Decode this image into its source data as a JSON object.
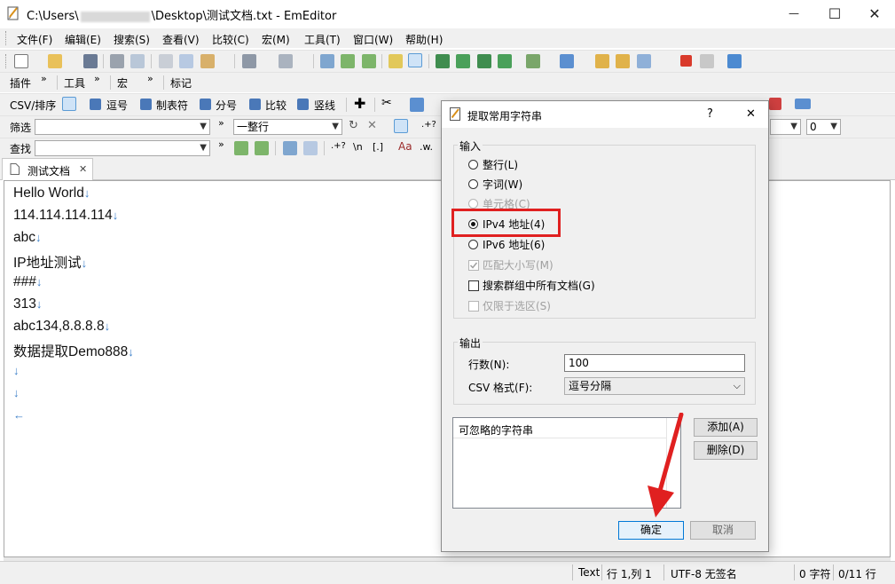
{
  "window": {
    "title_prefix": "C:\\Users\\",
    "title_suffix": "\\Desktop\\测试文档.txt - EmEditor",
    "minimize": "—",
    "maximize": "☐",
    "close": "✕"
  },
  "menu": [
    "文件(F)",
    "编辑(E)",
    "搜索(S)",
    "查看(V)",
    "比较(C)",
    "宏(M)",
    "工具(T)",
    "窗口(W)",
    "帮助(H)"
  ],
  "toolbar_rows": {
    "plugins": "插件",
    "tools": "工具",
    "macro": "宏",
    "mark": "标记",
    "more": "»"
  },
  "csv_bar": {
    "csv_sort": "CSV/排序",
    "comma": "逗号",
    "tab_char": "制表符",
    "semicolon": "分号",
    "compare": "比较",
    "pipe": "竖线"
  },
  "filter_bar": {
    "label": "筛选",
    "mode": "一整行",
    "right_value": "0"
  },
  "find_bar": {
    "label": "查找",
    "regex_sym": ".+?",
    "newline_sym": "\\n",
    "bracket_sym": "[.]",
    "case_sym": "Aa",
    "word_sym": ".w."
  },
  "tab": {
    "label": "测试文档",
    "close": "✕"
  },
  "editor_lines": [
    "Hello World",
    "114.114.114.114",
    "abc",
    "IP地址测试",
    "###",
    "313",
    "abc134,8.8.8.8",
    "数据提取Demo888",
    "",
    ""
  ],
  "lf_mark": "↓",
  "eof_mark": "←",
  "status": {
    "mode": "Text",
    "position": "行 1,列 1",
    "encoding": "UTF-8 无签名",
    "chars": "0 字符",
    "lines": "0/11 行"
  },
  "dialog": {
    "title": "提取常用字符串",
    "help": "?",
    "close": "✕",
    "input_group": "输入",
    "options": [
      {
        "label": "整行(L)",
        "type": "radio",
        "checked": false,
        "disabled": false
      },
      {
        "label": "字词(W)",
        "type": "radio",
        "checked": false,
        "disabled": false
      },
      {
        "label": "单元格(C)",
        "type": "radio",
        "checked": false,
        "disabled": true
      },
      {
        "label": "IPv4 地址(4)",
        "type": "radio",
        "checked": true,
        "disabled": false
      },
      {
        "label": "IPv6 地址(6)",
        "type": "radio",
        "checked": false,
        "disabled": false
      },
      {
        "label": "匹配大小写(M)",
        "type": "check",
        "checked": true,
        "disabled": true
      },
      {
        "label": "搜索群组中所有文档(G)",
        "type": "check",
        "checked": false,
        "disabled": false
      },
      {
        "label": "仅限于选区(S)",
        "type": "check",
        "checked": false,
        "disabled": true
      }
    ],
    "output_group": "输出",
    "rows_label": "行数(N):",
    "rows_value": "100",
    "csv_label": "CSV 格式(F):",
    "csv_value": "逗号分隔",
    "ignore_header": "可忽略的字符串",
    "add_button": "添加(A)",
    "delete_button": "删除(D)",
    "ok_button": "确定",
    "cancel_button": "取消"
  },
  "colors": {
    "highlight": "#e02020",
    "lf": "#3a7ec8",
    "toolbar": "#f0f0f0"
  }
}
